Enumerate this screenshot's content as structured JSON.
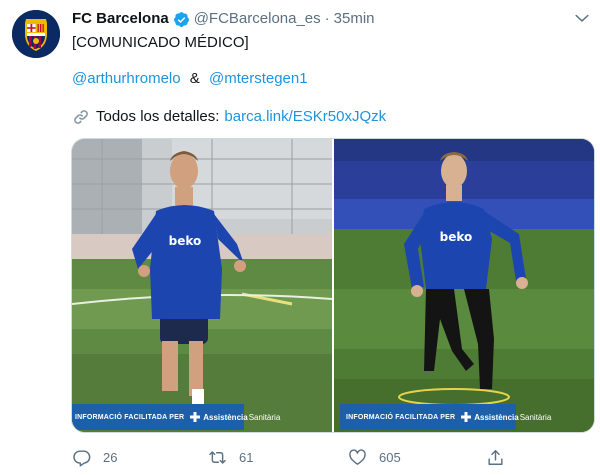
{
  "author": {
    "name": "FC Barcelona",
    "handle": "@FCBarcelona_es",
    "separator": "·",
    "time": "35min",
    "avatar_colors": {
      "blue": "#0b2a63",
      "garnet": "#a50044",
      "gold": "#edbb00"
    }
  },
  "tweet": {
    "line1": "[COMUNICADO MÉDICO]",
    "mention1": "@arthurhromelo",
    "connector": "&",
    "mention2": "@mterstegen1",
    "details_label": "Todos los detalles:",
    "details_link": "barca.link/ESKr50xJQzk"
  },
  "media": {
    "left": {
      "credit_label": "INFORMACIÓ FACILITADA PER",
      "credit_brand_bold": "Assistència",
      "credit_brand_light": "Sanitària"
    },
    "right": {
      "credit_label": "INFORMACIÓ FACILITADA PER",
      "credit_brand_bold": "Assistència",
      "credit_brand_light": "Sanitària"
    },
    "shirt_sponsor": "beko"
  },
  "actions": {
    "reply_count": "26",
    "retweet_count": "61",
    "like_count": "605"
  },
  "icons": {
    "verified": "verified-badge-icon",
    "caret": "chevron-down-icon",
    "link": "link-icon",
    "reply": "reply-icon",
    "retweet": "retweet-icon",
    "like": "heart-icon",
    "share": "share-icon"
  },
  "colors": {
    "link": "#1b95e0",
    "secondary_text": "#5b7083",
    "primary_text": "#0f1419",
    "credit_banner": "#1d5fa8"
  }
}
